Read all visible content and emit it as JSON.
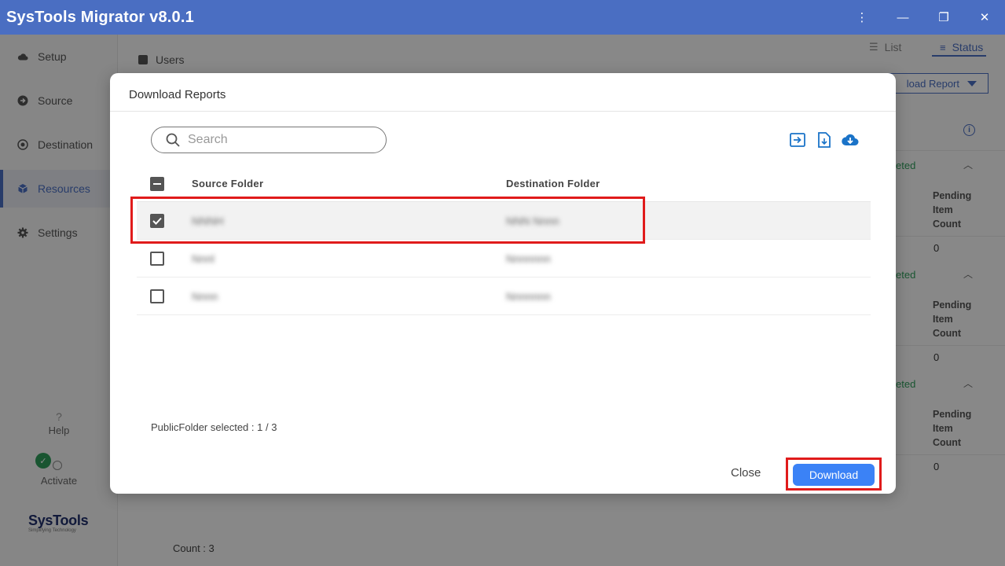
{
  "app": {
    "title": "SysTools Migrator v8.0.1"
  },
  "window_controls": [
    "more-icon",
    "minimize-icon",
    "restore-icon",
    "close-icon"
  ],
  "sidebar": {
    "items": [
      {
        "label": "Setup",
        "icon": "cloud-icon",
        "active": false
      },
      {
        "label": "Source",
        "icon": "arrow-right-circle-icon",
        "active": false
      },
      {
        "label": "Destination",
        "icon": "target-icon",
        "active": false
      },
      {
        "label": "Resources",
        "icon": "cube-icon",
        "active": true
      },
      {
        "label": "Settings",
        "icon": "gear-icon",
        "active": false
      }
    ],
    "help_label": "Help",
    "activate_label": "Activate",
    "logo": {
      "brand": "SysTools",
      "tagline": "Simplifying Technology"
    }
  },
  "main": {
    "users_label": "Users",
    "view_list_label": "List",
    "view_status_label": "Status",
    "download_report_label": "load Report",
    "status_blocks": [
      {
        "status": "eted",
        "pending_label_1": "Pending",
        "pending_label_2": "Item",
        "pending_label_3": "Count",
        "value": "0"
      },
      {
        "status": "eted",
        "pending_label_1": "Pending",
        "pending_label_2": "Item",
        "pending_label_3": "Count",
        "value": "0"
      },
      {
        "status": "eted",
        "pending_label_1": "Pending",
        "pending_label_2": "Item",
        "pending_label_3": "Count",
        "value": "0"
      }
    ],
    "count_label": "Count : 3"
  },
  "modal": {
    "title": "Download Reports",
    "search_placeholder": "Search",
    "columns": {
      "source": "Source Folder",
      "destination": "Destination Folder"
    },
    "rows": [
      {
        "checked": true,
        "source": "NNNH",
        "destination": "NNN Nnnn"
      },
      {
        "checked": false,
        "source": "Nnnl",
        "destination": "Nnnnnnn"
      },
      {
        "checked": false,
        "source": "Nnnn",
        "destination": "Nnnnnnn"
      }
    ],
    "selected_text": "PublicFolder selected : 1 / 3",
    "close_label": "Close",
    "download_label": "Download"
  },
  "colors": {
    "accent": "#4a6ec2",
    "button": "#3b82f6",
    "highlight": "#e01b1b",
    "success": "#2e9c5a"
  }
}
